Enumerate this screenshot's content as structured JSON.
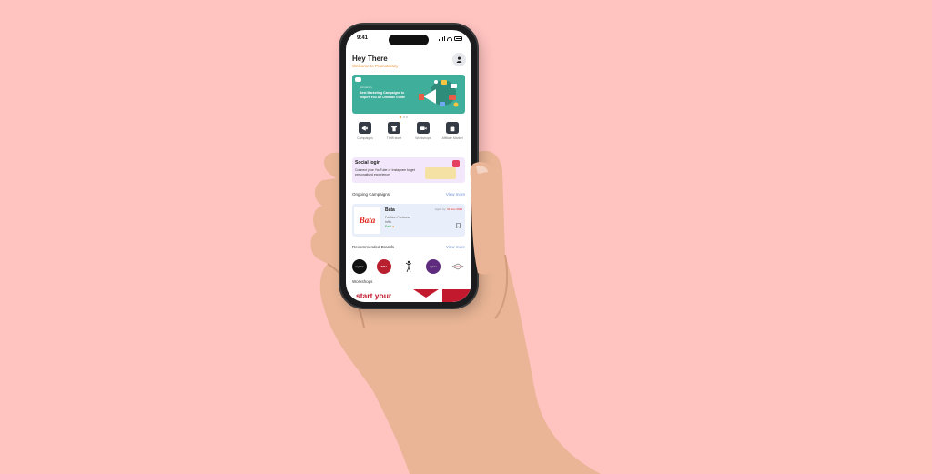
{
  "status_bar": {
    "time": "9:41"
  },
  "header": {
    "title": "Hey There",
    "subtitle": "Welcome to Promoterazy"
  },
  "banner": {
    "kicker": "promoterazy",
    "title": "Best Marketing Campaigns to Inspire You An Ultimate Guide",
    "slides": 3,
    "active_slide": 1
  },
  "quick_actions": [
    {
      "label": "Campaigns",
      "icon": "megaphone-icon"
    },
    {
      "label": "Thrift store",
      "icon": "shirt-icon"
    },
    {
      "label": "Workshops",
      "icon": "video-camera-icon"
    },
    {
      "label": "Affiliate Market",
      "icon": "shopping-bag-icon"
    }
  ],
  "social_login": {
    "title": "Social login",
    "description": "Connect your YouTube or Instagram to get personalised experience"
  },
  "ongoing": {
    "section_title": "Ongoing Campaigns",
    "view_more": "View more",
    "campaign": {
      "brand": "Bata",
      "category": "Fashion Footwear",
      "role": "Influ.",
      "payment": "Paid",
      "apply_label": "Apply by:",
      "apply_date": "31 Dec 2023"
    }
  },
  "recommended": {
    "section_title": "Recommended Brands",
    "view_more": "View more",
    "brands": [
      {
        "label": "myntra",
        "bg": "#111111"
      },
      {
        "label": "BIBA",
        "bg": "#B9202F"
      },
      {
        "label": "",
        "bg": "#ffffff"
      },
      {
        "label": "nykaa",
        "bg": "#5E2B7E"
      },
      {
        "label": "",
        "bg": "#ffffff"
      }
    ]
  },
  "workshops": {
    "section_title": "Workshops",
    "promo_text": "start your"
  },
  "colors": {
    "background": "#FFC3C0",
    "accent": "#F08A24",
    "banner": "#3FAE9A",
    "brand_red": "#C2192E",
    "link": "#6F8FD9"
  }
}
